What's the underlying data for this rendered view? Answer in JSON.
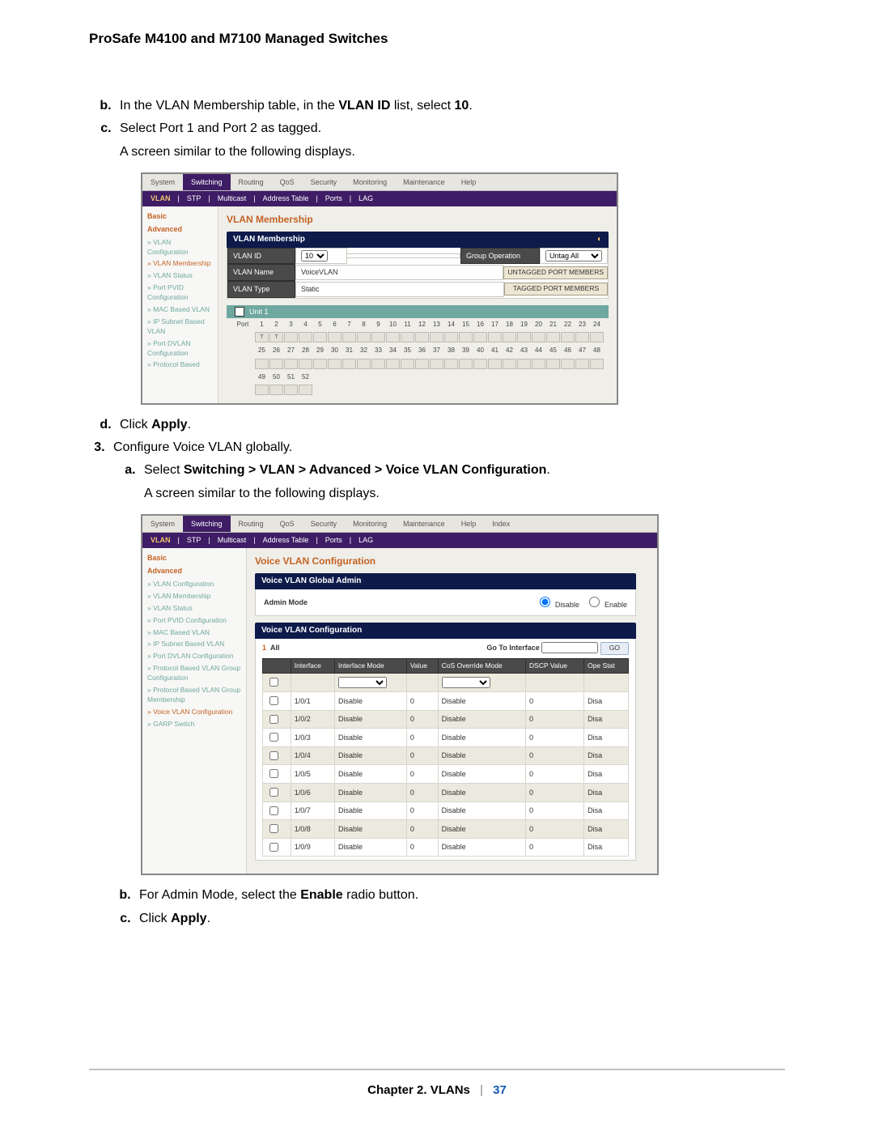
{
  "doc": {
    "title": "ProSafe M4100 and M7100 Managed Switches",
    "footer_chapter": "Chapter 2.  VLANs",
    "footer_page": "37"
  },
  "steps": {
    "b1": "In the VLAN Membership table, in the ",
    "b1_bold": "VLAN ID",
    "b1_tail": " list, select ",
    "b1_val": "10",
    "c1": "Select Port 1 and Port 2 as tagged.",
    "c1_after": "A screen similar to the following displays.",
    "d1_pre": "Click ",
    "d1_bold": "Apply",
    "num3": "Configure Voice VLAN globally.",
    "a2_pre": "Select ",
    "a2_bold": "Switching > VLAN > Advanced > Voice VLAN Configuration",
    "a2_after": "A screen similar to the following displays.",
    "b2_pre": "For Admin Mode, select the ",
    "b2_bold": "Enable",
    "b2_tail": " radio button.",
    "c2_pre": "Click ",
    "c2_bold": "Apply"
  },
  "tabs": [
    "System",
    "Switching",
    "Routing",
    "QoS",
    "Security",
    "Monitoring",
    "Maintenance",
    "Help"
  ],
  "tabs2": [
    "System",
    "Switching",
    "Routing",
    "QoS",
    "Security",
    "Monitoring",
    "Maintenance",
    "Help",
    "Index"
  ],
  "subtabs": [
    "VLAN",
    "STP",
    "Multicast",
    "Address Table",
    "Ports",
    "LAG"
  ],
  "side1": {
    "groups": [
      "Basic",
      "Advanced"
    ],
    "items": [
      "» VLAN Configuration",
      "» VLAN Membership",
      "» VLAN Status",
      "» Port PVID Configuration",
      "» MAC Based VLAN",
      "» IP Subnet Based VLAN",
      "» Port DVLAN Configuration",
      "» Protocol Based"
    ],
    "active_index": 1
  },
  "memb": {
    "title": "VLAN Membership",
    "panel_title": "VLAN Membership",
    "rows": {
      "id_label": "VLAN ID",
      "id_value": "10",
      "name_label": "VLAN Name",
      "name_value": "VoiceVLAN",
      "type_label": "VLAN Type",
      "type_value": "Static"
    },
    "ops": {
      "group_op": "Group Operation",
      "untag": "Untag All",
      "btn1": "UNTAGGED PORT MEMBERS",
      "btn2": "TAGGED PORT MEMBERS"
    },
    "unit": "Unit 1",
    "port_label": "Port",
    "ports_row1": [
      1,
      2,
      3,
      4,
      5,
      6,
      7,
      8,
      9,
      10,
      11,
      12,
      13,
      14,
      15,
      16,
      17,
      18,
      19,
      20,
      21,
      22,
      23,
      24
    ],
    "ports_row2": [
      25,
      26,
      27,
      28,
      29,
      30,
      31,
      32,
      33,
      34,
      35,
      36,
      37,
      38,
      39,
      40,
      41,
      42,
      43,
      44,
      45,
      46,
      47,
      48
    ],
    "ports_row3": [
      49,
      50,
      51,
      52
    ],
    "tagged_mark": "T"
  },
  "side2": {
    "groups": [
      "Basic",
      "Advanced"
    ],
    "items": [
      "» VLAN Configuration",
      "» VLAN Membership",
      "» VLAN Status",
      "» Port PVID Configuration",
      "» MAC Based VLAN",
      "» IP Subnet Based VLAN",
      "» Port DVLAN Configuration",
      "» Protocol Based VLAN Group Configuration",
      "» Protocol Based VLAN Group Membership",
      "» Voice VLAN Configuration",
      "» GARP Switch"
    ],
    "active_index": 9
  },
  "voice": {
    "title": "Voice VLAN Configuration",
    "panel1": "Voice VLAN Global Admin",
    "admin_label": "Admin Mode",
    "disable": "Disable",
    "enable": "Enable",
    "panel2": "Voice VLAN Configuration",
    "all_label": "All",
    "goto": "Go To Interface",
    "go": "GO",
    "headers": [
      "",
      "Interface",
      "Interface Mode",
      "Value",
      "CoS Override Mode",
      "DSCP Value",
      "Ope Stat"
    ],
    "rows": [
      {
        "if": "1/0/1",
        "mode": "Disable",
        "val": "0",
        "cos": "Disable",
        "dscp": "0",
        "stat": "Disa"
      },
      {
        "if": "1/0/2",
        "mode": "Disable",
        "val": "0",
        "cos": "Disable",
        "dscp": "0",
        "stat": "Disa"
      },
      {
        "if": "1/0/3",
        "mode": "Disable",
        "val": "0",
        "cos": "Disable",
        "dscp": "0",
        "stat": "Disa"
      },
      {
        "if": "1/0/4",
        "mode": "Disable",
        "val": "0",
        "cos": "Disable",
        "dscp": "0",
        "stat": "Disa"
      },
      {
        "if": "1/0/5",
        "mode": "Disable",
        "val": "0",
        "cos": "Disable",
        "dscp": "0",
        "stat": "Disa"
      },
      {
        "if": "1/0/6",
        "mode": "Disable",
        "val": "0",
        "cos": "Disable",
        "dscp": "0",
        "stat": "Disa"
      },
      {
        "if": "1/0/7",
        "mode": "Disable",
        "val": "0",
        "cos": "Disable",
        "dscp": "0",
        "stat": "Disa"
      },
      {
        "if": "1/0/8",
        "mode": "Disable",
        "val": "0",
        "cos": "Disable",
        "dscp": "0",
        "stat": "Disa"
      },
      {
        "if": "1/0/9",
        "mode": "Disable",
        "val": "0",
        "cos": "Disable",
        "dscp": "0",
        "stat": "Disa"
      }
    ]
  }
}
